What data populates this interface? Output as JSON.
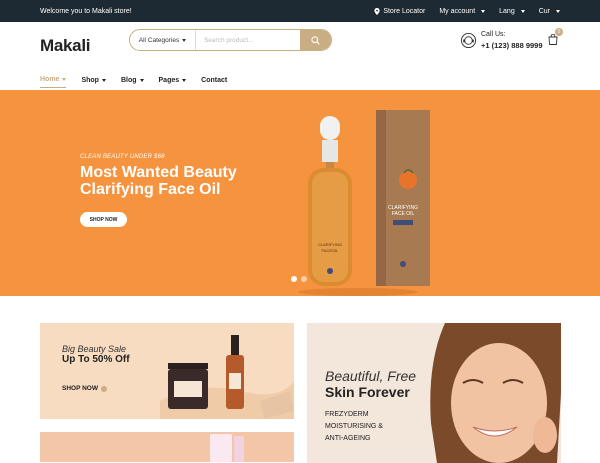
{
  "topbar": {
    "welcome": "Welcome you to Makali store!",
    "store_locator": "Store Locator",
    "account": "My account",
    "lang": "Lang",
    "cur": "Cur"
  },
  "header": {
    "logo": "Makali",
    "search_category": "All Categories",
    "search_placeholder": "Search product...",
    "call_label": "Call Us:",
    "phone": "+1 (123) 888 9999",
    "cart_count": "0"
  },
  "nav": {
    "items": [
      {
        "label": "Home",
        "active": true,
        "dropdown": true
      },
      {
        "label": "Shop",
        "dropdown": true
      },
      {
        "label": "Blog",
        "dropdown": true
      },
      {
        "label": "Pages",
        "dropdown": true
      },
      {
        "label": "Contact",
        "dropdown": false
      }
    ]
  },
  "hero": {
    "subtitle": "CLEAN BEAUTY UNDER $68",
    "title_line1": "Most Wanted Beauty",
    "title_line2": "Clarifying Face Oil",
    "button": "SHOP NOW",
    "product_box_label": "CLARIFYING FACE OIL",
    "product_bottle_label": "CLARIFYING FACEOIL",
    "slides": 2,
    "active_slide": 1
  },
  "banners": {
    "left_top": {
      "subtitle": "Big Beauty Sale",
      "title": "Up To 50% Off",
      "link": "SHOP NOW"
    },
    "right": {
      "subtitle": "Beautiful, Free",
      "title": "Skin Forever",
      "desc_line1": "FREZYDERM",
      "desc_line2": "MOISTURISING &",
      "desc_line3": "ANTI-AGEING"
    }
  },
  "colors": {
    "topbar_bg": "#1d2a33",
    "accent": "#c8ae82",
    "hero_bg": "#f6933e"
  }
}
